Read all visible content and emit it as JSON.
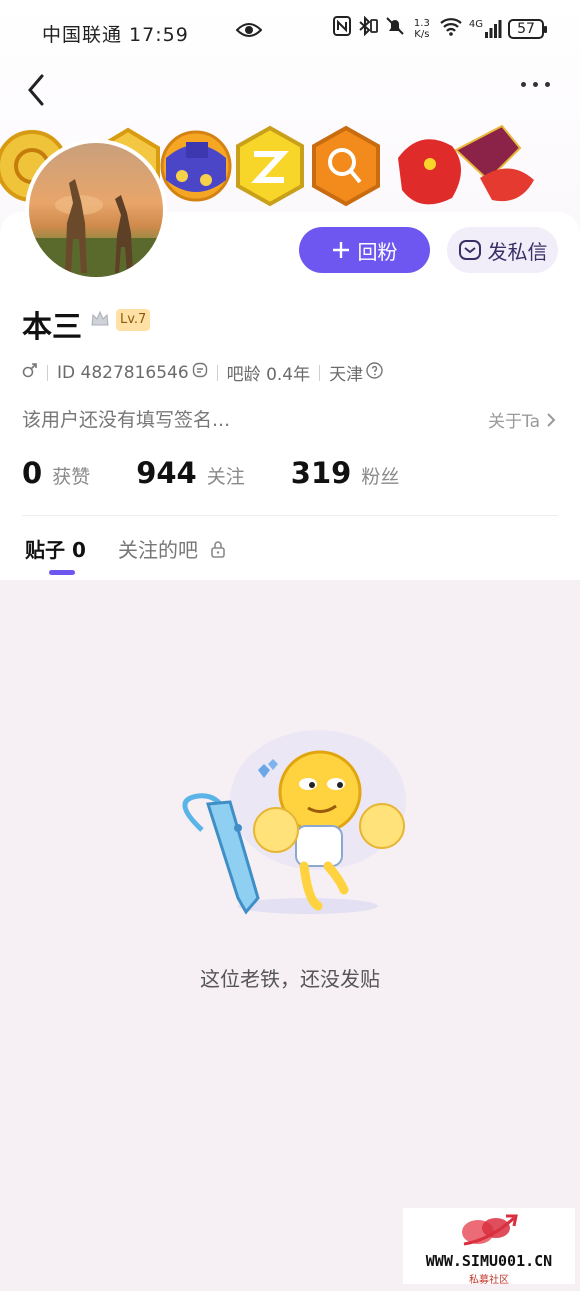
{
  "status_bar": {
    "carrier_time": "中国联通 17:59",
    "net_speed_value": "1.3",
    "net_speed_unit": "K/s",
    "signal": "4G",
    "battery": "57"
  },
  "nav": {
    "back_icon": "chevron-left-icon",
    "more_icon": "more-dots-icon"
  },
  "badges": [
    "gold-badge-1",
    "gold-badge-2",
    "blue-badge",
    "yellow-badge",
    "orange-badge",
    "red-zodiac-badge"
  ],
  "profile": {
    "name": "本三",
    "level": "Lv.7",
    "gender_icon": "male",
    "id_text": "ID 4827816546",
    "bar_age": "吧龄 0.4年",
    "location": "天津",
    "signature": "该用户还没有填写签名...",
    "about_label": "关于Ta"
  },
  "buttons": {
    "follow_back": "回粉",
    "message": "发私信"
  },
  "stats": [
    {
      "num": "0",
      "label": "获赞"
    },
    {
      "num": "944",
      "label": "关注"
    },
    {
      "num": "319",
      "label": "粉丝"
    }
  ],
  "tabs": {
    "posts": "贴子 0",
    "followed_bars": "关注的吧"
  },
  "empty": {
    "text": "这位老铁，还没发贴"
  },
  "watermark": {
    "url": "WWW.SIMU001.CN",
    "sub": "私募社区"
  },
  "colors": {
    "accent": "#6e57f0",
    "page_bg": "#f6f0f5",
    "level_bg": "#ffe1a6"
  }
}
